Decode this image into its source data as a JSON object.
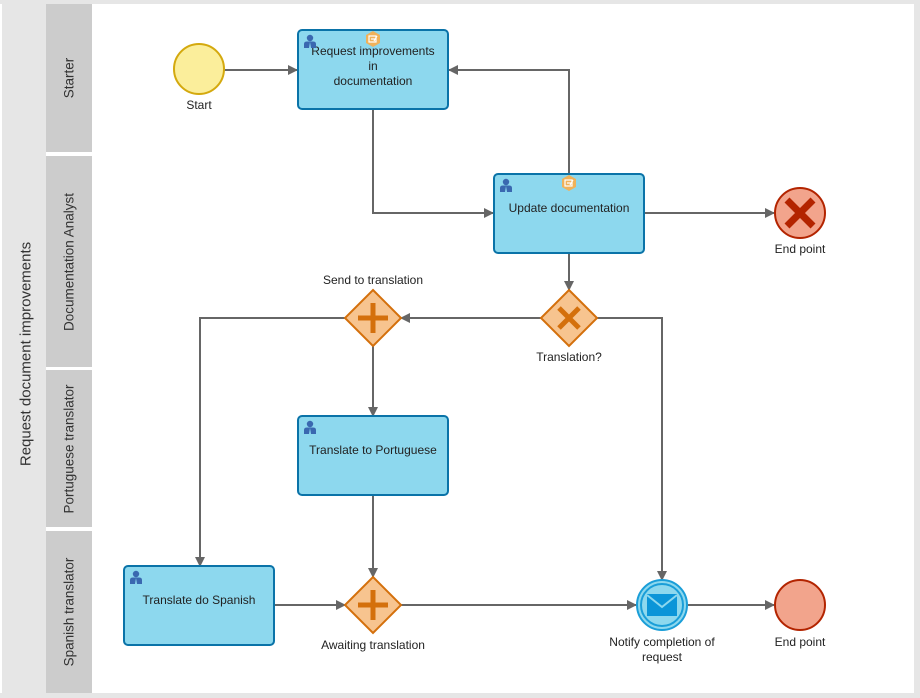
{
  "pool": {
    "label": "Request document improvements"
  },
  "lanes": [
    {
      "label": "Starter"
    },
    {
      "label": "Documentation Analyst"
    },
    {
      "label": "Portuguese translator"
    },
    {
      "label": "Spanish translator"
    }
  ],
  "events": {
    "start": {
      "label": "Start",
      "type": "start-event",
      "fill": "#fbee9b",
      "stroke": "#d4a90e"
    },
    "end_error": {
      "label": "End point",
      "type": "error-end-event",
      "fill": "#f2a48c",
      "stroke": "#b32400"
    },
    "end_plain": {
      "label": "End point",
      "type": "end-event",
      "fill": "#f2a48c",
      "stroke": "#b32400"
    },
    "notify": {
      "label_line1": "Notify completion of",
      "label_line2": "request",
      "type": "message-throw-event",
      "fill": "#8dd8ee",
      "stroke": "#1a9ed8"
    }
  },
  "tasks": {
    "request": {
      "label_line1": "Request improvements in",
      "label_line2": "documentation",
      "icon": "user-icon",
      "marker": "form-icon"
    },
    "update": {
      "label": "Update documentation",
      "icon": "user-icon",
      "marker": "form-icon"
    },
    "portuguese": {
      "label": "Translate to Portuguese",
      "icon": "user-icon"
    },
    "spanish": {
      "label": "Translate do Spanish",
      "icon": "user-icon"
    }
  },
  "gateways": {
    "send": {
      "label": "Send to translation",
      "type": "parallel"
    },
    "translation": {
      "label": "Translation?",
      "type": "exclusive"
    },
    "awaiting": {
      "label": "Awaiting translation",
      "type": "parallel"
    }
  },
  "colors": {
    "task_fill": "#8dd8ee",
    "task_stroke": "#0a73a8",
    "gateway_fill": "#f7c48f",
    "gateway_stroke": "#d4700c",
    "flow": "#666666",
    "lane_header": "#cccccc",
    "pool_band": "#e6e6e6"
  }
}
